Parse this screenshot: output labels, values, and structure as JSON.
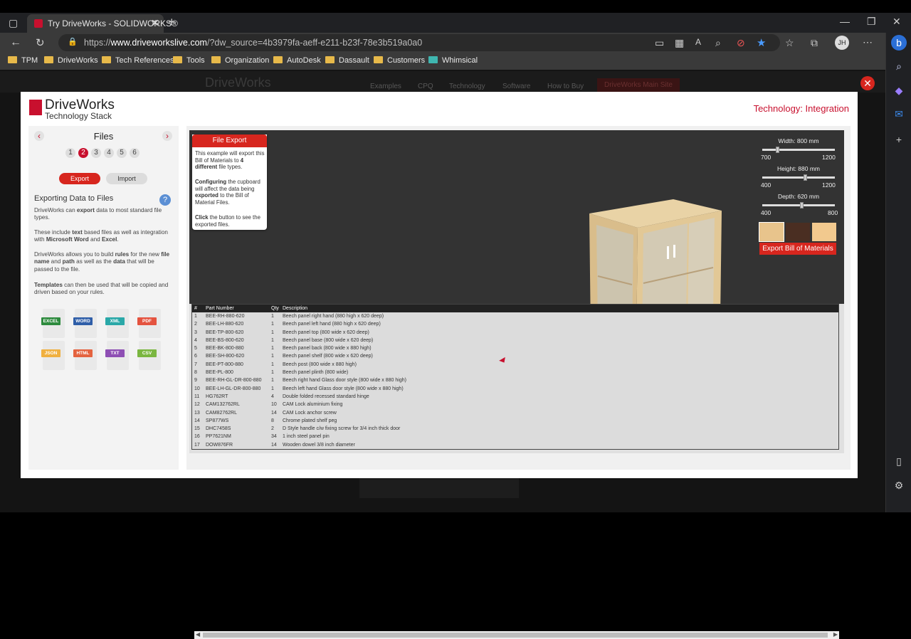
{
  "browser": {
    "tab_title": "Try DriveWorks - SOLIDWORKS®",
    "url_prefix": "https://",
    "url_domain": "www.driveworkslive.com",
    "url_rest": "/?dw_source=4b3979fa-aeff-e211-b23f-78e3b519a0a0",
    "profile_initials": "JH",
    "bookmarks": [
      "TPM",
      "DriveWorks",
      "Tech References",
      "Tools",
      "Organization",
      "AutoDesk",
      "Dassault",
      "Customers",
      "Whimsical"
    ]
  },
  "site": {
    "nav": [
      "Examples",
      "CPQ",
      "Technology",
      "Software",
      "How to Buy",
      "DriveWorks Main Site"
    ],
    "logo": "DriveWorks"
  },
  "modal": {
    "logo_name": "DriveWorks",
    "logo_sub": "Technology Stack",
    "heading": "Technology: Integration",
    "close_glyph": "✕",
    "files_title": "Files",
    "steps": [
      "1",
      "2",
      "3",
      "4",
      "5",
      "6"
    ],
    "export_label": "Export",
    "import_label": "Import",
    "section_title": "Exporting Data to Files",
    "help_glyph": "?",
    "paras": [
      [
        "DriveWorks can ",
        "export",
        " data to most standard file types."
      ],
      [
        "These include ",
        "text",
        " based files as well as integration with ",
        "Microsoft Word",
        " and ",
        "Excel",
        "."
      ],
      [
        "DriveWorks allows you to build ",
        "rules",
        " for the new ",
        "file name",
        " and ",
        "path",
        " as well as the ",
        "data",
        " that will be passed to the file."
      ],
      [
        "",
        "Templates",
        " can then be used that will be copied and driven based on your rules."
      ]
    ],
    "file_types": [
      "EXCEL",
      "WORD",
      "XML",
      "PDF",
      "JSON",
      "HTML",
      "TXT",
      "CSV"
    ],
    "file_colors": [
      "#2e8b3e",
      "#2f5ea8",
      "#2aa8a8",
      "#e4533f",
      "#f0b040",
      "#e4633f",
      "#8e4fb4",
      "#7ab640"
    ],
    "tip_title": "File Export",
    "tip_p1": [
      "This example will export this Bill of Materials to ",
      "4 different",
      " file types."
    ],
    "tip_p2": [
      "",
      "Configuring",
      " the cupboard will affect the data being ",
      "exported",
      " to the Bill of Material Files."
    ],
    "tip_p3": [
      "",
      "Click",
      " the button to see the exported files."
    ],
    "sliders": [
      {
        "label": "Width: 800 mm",
        "min": "700",
        "max": "1200",
        "value": 0.2
      },
      {
        "label": "Height: 880 mm",
        "min": "400",
        "max": "1200",
        "value": 0.6
      },
      {
        "label": "Depth: 620 mm",
        "min": "400",
        "max": "800",
        "value": 0.55
      }
    ],
    "swatches": [
      "#e8c48c",
      "#4a2e22",
      "#f2c98e"
    ],
    "export_bom_label": "Export Bill of Materials",
    "bom_headers": [
      "#",
      "Part Number",
      "Qty",
      "Description"
    ],
    "bom_rows": [
      [
        "1",
        "BEE-RH-880-620",
        "1",
        "Beech panel right hand (880 high x 620 deep)"
      ],
      [
        "2",
        "BEE-LH-880-620",
        "1",
        "Beech panel left hand (880 high x 620 deep)"
      ],
      [
        "3",
        "BEE-TP-800-620",
        "1",
        "Beech panel top (800 wide x 620 deep)"
      ],
      [
        "4",
        "BEE-BS-800-620",
        "1",
        "Beech panel base (800 wide x 620 deep)"
      ],
      [
        "5",
        "BEE-BK-800-880",
        "1",
        "Beech panel back (800 wide x 880 high)"
      ],
      [
        "6",
        "BEE-SH-800-620",
        "1",
        "Beech panel shelf (800 wide x 620 deep)"
      ],
      [
        "7",
        "BEE-PT-800-880",
        "1",
        "Beech post (800 wide x 880 high)"
      ],
      [
        "8",
        "BEE-PL-800",
        "1",
        "Beech panel plinth (800 wide)"
      ],
      [
        "9",
        "BEE-RH-GL-DR-800-880",
        "1",
        "Beech right hand Glass door style (800 wide x 880 high)"
      ],
      [
        "10",
        "BEE-LH-GL-DR-800-880",
        "1",
        "Beech left hand Glass door style (800 wide x 880 high)"
      ],
      [
        "11",
        "HG762RT",
        "4",
        "Double folded recessed standard hinge"
      ],
      [
        "12",
        "CAM132762RL",
        "10",
        "CAM Lock aluminium fixing"
      ],
      [
        "13",
        "CAM82762RL",
        "14",
        "CAM Lock anchor screw"
      ],
      [
        "14",
        "SP877WS",
        "8",
        "Chrome plated shelf peg"
      ],
      [
        "15",
        "DHC7458S",
        "2",
        "D Style handle c/w fixing screw for 3/4 inch thick door"
      ],
      [
        "16",
        "PP7621NM",
        "34",
        "1 inch steel panel pin"
      ],
      [
        "17",
        "DOW876FR",
        "14",
        "Wooden dowel 3/8 inch diameter"
      ]
    ]
  }
}
